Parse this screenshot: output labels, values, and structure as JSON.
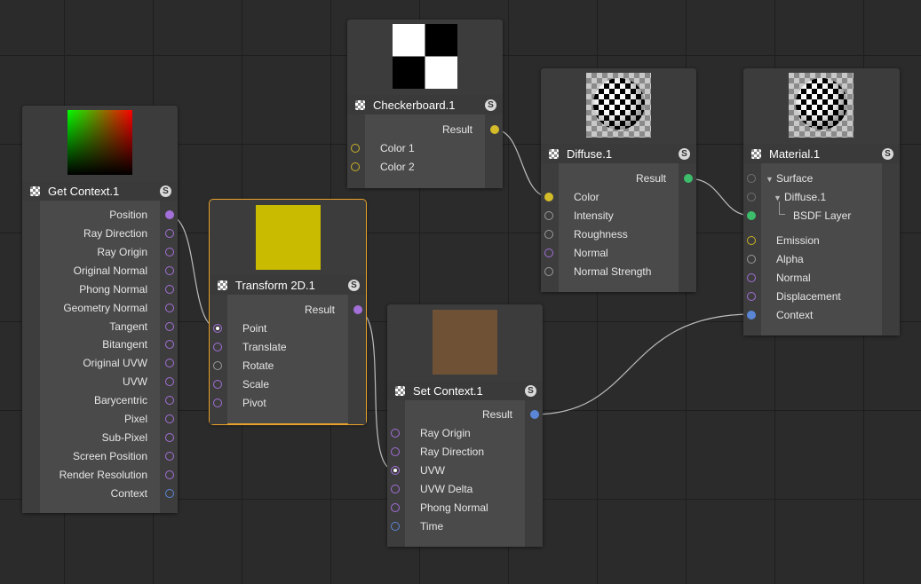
{
  "colors": {
    "purple": "#a36fd8",
    "yellow": "#c9b227",
    "gray": "#9a9a9a",
    "blue": "#5b86d6",
    "green": "#3dbd6b",
    "gold_fill": "#d4bb2a",
    "selection": "#e8a22a"
  },
  "nodes": {
    "get_context": {
      "title": "Get Context.1",
      "s": "S",
      "outputs": [
        "Position",
        "Ray Direction",
        "Ray Origin",
        "Original Normal",
        "Phong Normal",
        "Geometry Normal",
        "Tangent",
        "Bitangent",
        "Original UVW",
        "UVW",
        "Barycentric",
        "Pixel",
        "Sub-Pixel",
        "Screen Position",
        "Render Resolution",
        "Context"
      ]
    },
    "transform2d": {
      "title": "Transform 2D.1",
      "s": "S",
      "result": "Result",
      "inputs": [
        "Point",
        "Translate",
        "Rotate",
        "Scale",
        "Pivot"
      ]
    },
    "checkerboard": {
      "title": "Checkerboard.1",
      "s": "S",
      "result": "Result",
      "inputs": [
        "Color 1",
        "Color 2"
      ]
    },
    "set_context": {
      "title": "Set Context.1",
      "s": "S",
      "result": "Result",
      "inputs": [
        "Ray Origin",
        "Ray Direction",
        "UVW",
        "UVW Delta",
        "Phong Normal",
        "Time"
      ]
    },
    "diffuse": {
      "title": "Diffuse.1",
      "s": "S",
      "result": "Result",
      "inputs": [
        "Color",
        "Intensity",
        "Roughness",
        "Normal",
        "Normal Strength"
      ]
    },
    "material": {
      "title": "Material.1",
      "s": "S",
      "tree": [
        "Surface",
        "Diffuse.1",
        "BSDF Layer"
      ],
      "inputs": [
        "Emission",
        "Alpha",
        "Normal",
        "Displacement",
        "Context"
      ]
    }
  }
}
